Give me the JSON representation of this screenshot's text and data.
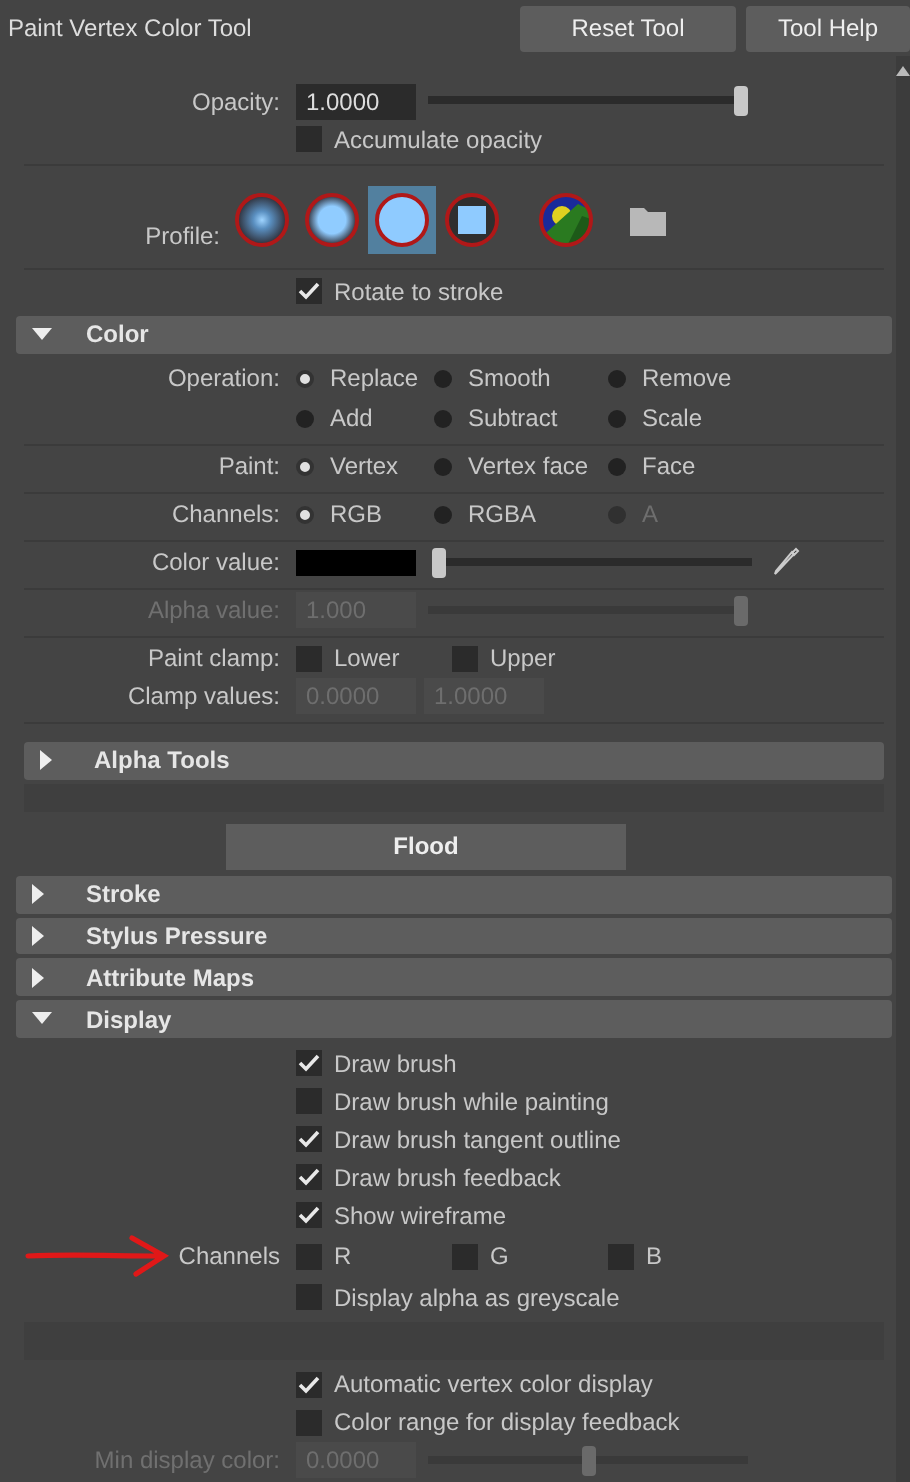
{
  "window": {
    "title": "Paint Vertex Color Tool"
  },
  "toolbar": {
    "buttons": [
      "Reset Tool",
      "Tool Help"
    ]
  },
  "top_groups": [
    {
      "kind": "lined",
      "rows": [
        {
          "kind": "field_slider",
          "label": "Opacity:",
          "value": "1.0000",
          "level": 1,
          "disabled": false
        },
        {
          "kind": "checks",
          "items": [
            {
              "label": "Accumulate opacity",
              "checked": false
            }
          ]
        }
      ]
    },
    {
      "kind": "lined",
      "rows": [
        {
          "kind": "profile",
          "label": "Profile:",
          "items": [
            {
              "kind": "soft",
              "selected": false
            },
            {
              "kind": "medium",
              "selected": false
            },
            {
              "kind": "hard",
              "selected": true
            },
            {
              "kind": "square",
              "selected": false
            },
            {
              "kind": "image",
              "selected": false
            },
            {
              "kind": "folder",
              "selected": false
            }
          ]
        }
      ]
    },
    {
      "kind": "lined",
      "rows": [
        {
          "kind": "checks",
          "items": [
            {
              "label": "Rotate to stroke",
              "checked": true
            }
          ]
        }
      ]
    }
  ],
  "sections": [
    {
      "kind": "header",
      "title": "Color",
      "expanded": true,
      "groups": [
        {
          "kind": "lined",
          "rows": [
            {
              "kind": "radios",
              "label": "Operation:",
              "items": [
                {
                  "label": "Replace",
                  "selected": true,
                  "disabled": false
                },
                {
                  "label": "Smooth",
                  "selected": false,
                  "disabled": false
                },
                {
                  "label": "Remove",
                  "selected": false,
                  "disabled": false
                },
                {
                  "label": "Add",
                  "selected": false,
                  "disabled": false
                },
                {
                  "label": "Subtract",
                  "selected": false,
                  "disabled": false
                },
                {
                  "label": "Scale",
                  "selected": false,
                  "disabled": false
                }
              ]
            }
          ]
        },
        {
          "kind": "lined",
          "rows": [
            {
              "kind": "radios",
              "label": "Paint:",
              "items": [
                {
                  "label": "Vertex",
                  "selected": true,
                  "disabled": false
                },
                {
                  "label": "Vertex face",
                  "selected": false,
                  "disabled": false
                },
                {
                  "label": "Face",
                  "selected": false,
                  "disabled": false
                }
              ]
            }
          ]
        },
        {
          "kind": "lined",
          "rows": [
            {
              "kind": "radios",
              "label": "Channels:",
              "items": [
                {
                  "label": "RGB",
                  "selected": true,
                  "disabled": false
                },
                {
                  "label": "RGBA",
                  "selected": false,
                  "disabled": false
                },
                {
                  "label": "A",
                  "selected": false,
                  "disabled": true
                }
              ]
            }
          ]
        },
        {
          "kind": "lined",
          "rows": [
            {
              "kind": "color_slider",
              "label": "Color value:",
              "level": 0
            }
          ]
        },
        {
          "kind": "lined",
          "rows": [
            {
              "kind": "field_slider",
              "label": "Alpha value:",
              "value": "1.000",
              "level": 1,
              "disabled": true
            }
          ]
        },
        {
          "kind": "lined",
          "rows": [
            {
              "kind": "checks",
              "label": "Paint clamp:",
              "items": [
                {
                  "label": "Lower",
                  "checked": false
                },
                {
                  "label": "Upper",
                  "checked": false
                }
              ]
            },
            {
              "kind": "fields",
              "label": "Clamp values:",
              "values": [
                "0.0000",
                "1.0000"
              ],
              "disabled": true
            }
          ]
        },
        {
          "kind": "lined",
          "rows": [
            {
              "kind": "subheader",
              "title": "Alpha Tools",
              "expanded": false
            }
          ]
        },
        {
          "kind": "plain",
          "rows": [
            {
              "kind": "button",
              "label": "Flood"
            }
          ]
        }
      ]
    },
    {
      "kind": "header",
      "title": "Stroke",
      "expanded": false
    },
    {
      "kind": "header",
      "title": "Stylus Pressure",
      "expanded": false
    },
    {
      "kind": "header",
      "title": "Attribute Maps",
      "expanded": false
    },
    {
      "kind": "header",
      "title": "Display",
      "expanded": true,
      "groups": [
        {
          "kind": "plain",
          "rows": [
            {
              "kind": "checks",
              "items": [
                {
                  "label": "Draw brush",
                  "checked": true
                }
              ]
            },
            {
              "kind": "checks",
              "items": [
                {
                  "label": "Draw brush while painting",
                  "checked": false
                }
              ]
            },
            {
              "kind": "checks",
              "items": [
                {
                  "label": "Draw brush tangent outline",
                  "checked": true
                }
              ]
            },
            {
              "kind": "checks",
              "items": [
                {
                  "label": "Draw brush feedback",
                  "checked": true
                }
              ]
            },
            {
              "kind": "checks",
              "items": [
                {
                  "label": "Show wireframe",
                  "checked": true
                }
              ]
            },
            {
              "kind": "checks",
              "label": "Channels",
              "annotation_arrow": true,
              "items": [
                {
                  "label": "R",
                  "checked": false
                },
                {
                  "label": "G",
                  "checked": false
                },
                {
                  "label": "B",
                  "checked": false
                }
              ]
            },
            {
              "kind": "checks",
              "items": [
                {
                  "label": "Display alpha as greyscale",
                  "checked": false
                }
              ]
            }
          ]
        },
        {
          "kind": "banded",
          "rows": [
            {
              "kind": "checks",
              "items": [
                {
                  "label": "Automatic vertex color display",
                  "checked": true
                }
              ]
            },
            {
              "kind": "checks",
              "items": [
                {
                  "label": "Color range for display feedback",
                  "checked": false
                }
              ]
            },
            {
              "kind": "field_slider",
              "label": "Min display color:",
              "value": "0.0000",
              "level": 0.5,
              "disabled": true
            }
          ]
        }
      ]
    }
  ]
}
